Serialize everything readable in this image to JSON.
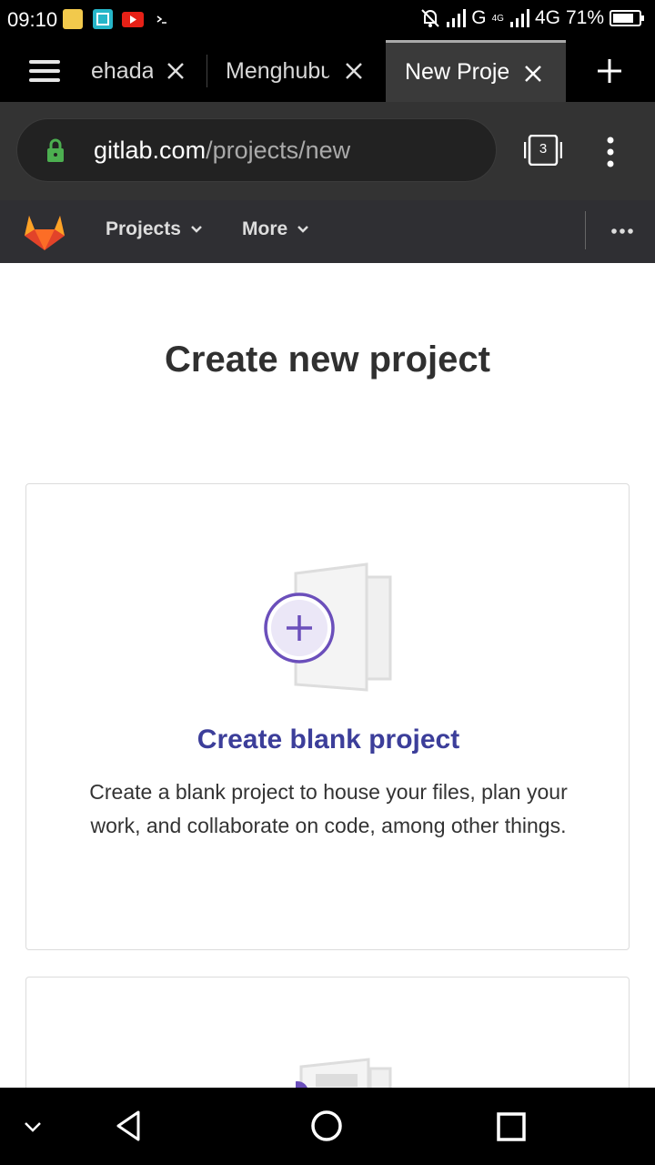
{
  "status_bar": {
    "time": "09:10",
    "network_g": "G",
    "network_4g_small": "4G",
    "network_4g": "4G",
    "battery": "71%",
    "icons": [
      "notes-app-icon",
      "scanner-app-icon",
      "youtube-icon",
      "terminal-icon",
      "muted-bell-icon",
      "signal-icon",
      "battery-icon"
    ]
  },
  "browser": {
    "tabs": [
      {
        "label": "ehada"
      },
      {
        "label": "Menghubu"
      },
      {
        "label": "New Proje"
      }
    ],
    "url": {
      "host": "gitlab.com",
      "path": "/projects/new"
    },
    "tab_count": "3"
  },
  "gitlab_nav": {
    "items": [
      {
        "label": "Projects"
      },
      {
        "label": "More"
      }
    ]
  },
  "page": {
    "title": "Create new project",
    "cards": [
      {
        "title": "Create blank project",
        "description": "Create a blank project to house your files, plan your work, and collaborate on code, among other things."
      }
    ]
  },
  "colors": {
    "accent_purple": "#6b4fbb",
    "card_title": "#3c3e9a",
    "gitlab_orange": "#fc6d26",
    "lock_green": "#4caf50"
  }
}
